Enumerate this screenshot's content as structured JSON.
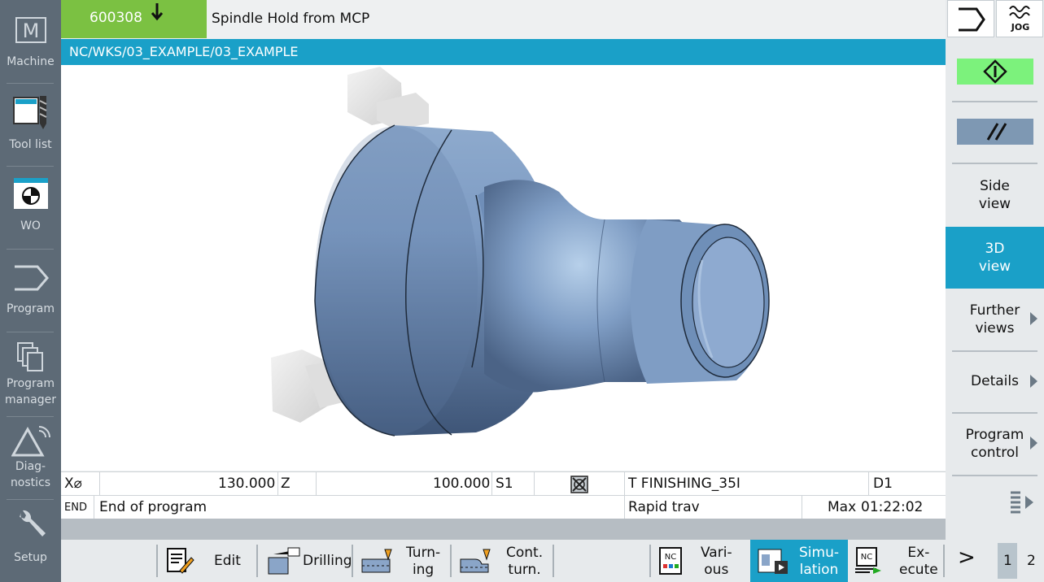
{
  "sidebar": {
    "items": [
      {
        "label": "Machine",
        "icon": "machine-icon"
      },
      {
        "label": "Tool list",
        "icon": "tool-list-icon"
      },
      {
        "label": "WO",
        "icon": "work-offset-icon"
      },
      {
        "label": "Program",
        "icon": "program-icon"
      },
      {
        "label": "Program\nmanager",
        "icon": "program-manager-icon"
      },
      {
        "label": "Diag-\nnostics",
        "icon": "diagnostics-icon"
      },
      {
        "label": "Setup",
        "icon": "setup-icon"
      }
    ]
  },
  "header": {
    "alarm_number": "600308",
    "alarm_text": "Spindle Hold from MCP",
    "program_path": "NC/WKS/03_EXAMPLE/03_EXAMPLE"
  },
  "status": {
    "x_label": "X⌀",
    "x_value": "130.000",
    "z_label": "Z",
    "z_value": "100.000",
    "s_label": "S1",
    "tool": "T FINISHING_35I",
    "d_label": "D1",
    "end_code": "END",
    "message": "End of program",
    "feed_mode": "Rapid trav",
    "time_label": "Max",
    "time_value": "01:22:02"
  },
  "right_panel": {
    "jog_label": "JOG",
    "side_view": "Side\nview",
    "view_3d": "3D\nview",
    "further_views": "Further\nviews",
    "details": "Details",
    "program_control": "Program\ncontrol"
  },
  "bottom_bar": {
    "edit": "Edit",
    "drilling": "Drilling",
    "turning": "Turn-\ning",
    "cont_turn": "Cont.\nturn.",
    "various": "Vari-\nous",
    "simulation": "Simu-\nlation",
    "execute": "Ex-\necute",
    "next": ">",
    "page1": "1",
    "page2": "2",
    "nc_badge": "NC"
  },
  "colors": {
    "accent_blue": "#1aa0c8",
    "alarm_green": "#7bc142",
    "cycle_start_green": "#7cf27c",
    "sidebar_grey": "#5d6a76",
    "part_blue": "#6f8fb8"
  }
}
